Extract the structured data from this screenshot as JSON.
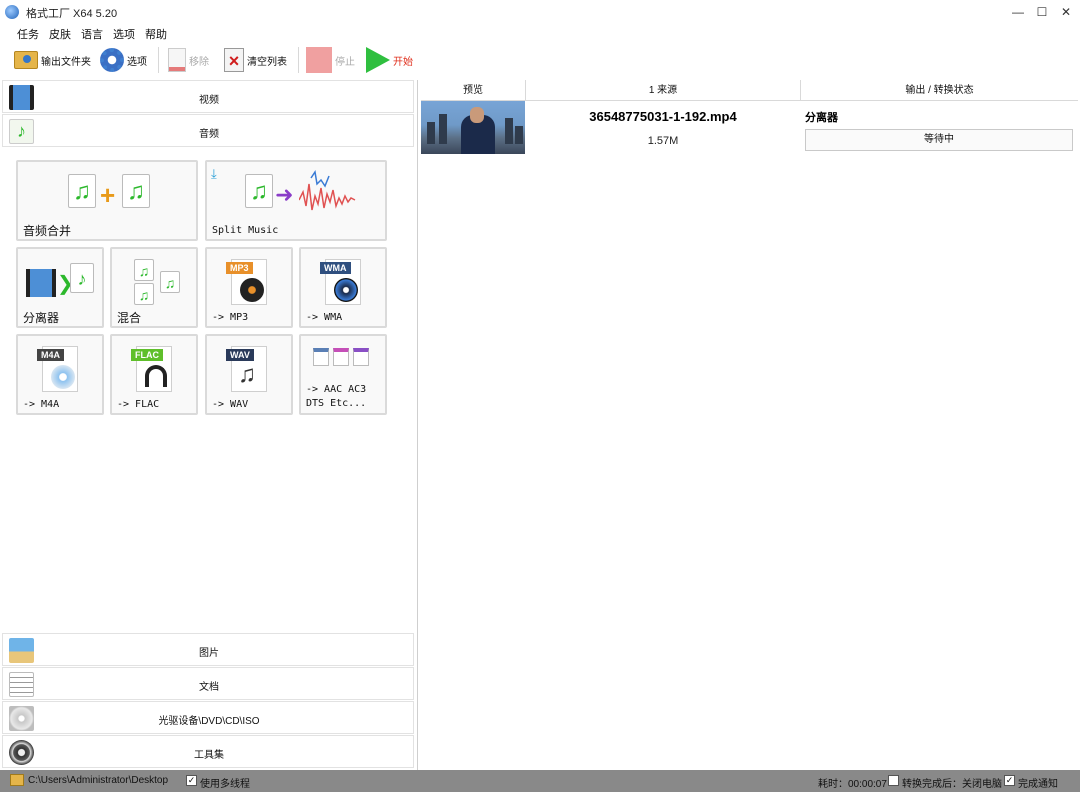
{
  "window": {
    "title": "格式工厂 X64 5.20",
    "minimize": "—",
    "maximize": "☐",
    "close": "✕"
  },
  "menu": [
    "任务",
    "皮肤",
    "语言",
    "选项",
    "帮助"
  ],
  "toolbar": {
    "output_folder": "输出文件夹",
    "options": "选项",
    "remove": "移除",
    "clear_list": "清空列表",
    "stop": "停止",
    "start": "开始"
  },
  "categories": {
    "video": "视频",
    "audio": "音频",
    "picture": "图片",
    "document": "文档",
    "disc": "光驱设备\\DVD\\CD\\ISO",
    "tools": "工具集"
  },
  "audio_tiles": {
    "merge": "音频合并",
    "split": "Split Music",
    "demuxer": "分离器",
    "mix": "混合",
    "to_mp3": "-> MP3",
    "to_wma": "-> WMA",
    "to_m4a": "-> M4A",
    "to_flac": "-> FLAC",
    "to_wav": "-> WAV",
    "to_other_line1": "-> AAC AC3",
    "to_other_line2": "DTS Etc..."
  },
  "format_tags": {
    "mp3": "MP3",
    "wma": "WMA",
    "m4a": "M4A",
    "flac": "FLAC",
    "wav": "WAV"
  },
  "table": {
    "headers": [
      "预览",
      "1 来源",
      "输出 / 转换状态"
    ],
    "rows": [
      {
        "file": "36548775031-1-192.mp4",
        "size": "1.57M",
        "output": "分离器",
        "status": "等待中"
      }
    ]
  },
  "statusbar": {
    "path": "C:\\Users\\Administrator\\Desktop",
    "multithread": "使用多线程",
    "elapsed": "耗时：00:00:07",
    "after_convert": "转换完成后：关闭电脑",
    "notify": "完成通知"
  },
  "colors": {
    "accent_green": "#2fbf3f",
    "note_green": "#2cb82c",
    "statusbar": "#898989"
  }
}
